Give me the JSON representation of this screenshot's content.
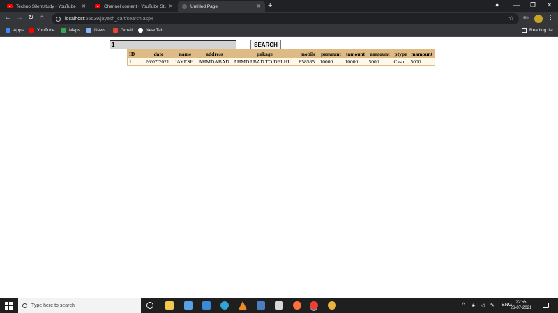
{
  "browser": {
    "tabs": [
      {
        "title": "Techno Silentstudy - YouTube",
        "close": "✕"
      },
      {
        "title": "Channel content - YouTube Studio",
        "close": "✕"
      },
      {
        "title": "Untitled Page",
        "close": "✕"
      }
    ],
    "new_tab": "+",
    "window_controls": {
      "minimize": "—",
      "maximize": "❐",
      "close": "✕"
    },
    "nav": {
      "back": "←",
      "forward": "→",
      "reload": "↻",
      "home": "⌂"
    },
    "address": {
      "host": "localhost",
      "path": ":56639/jayesh_cart/search.aspx"
    },
    "star": "☆",
    "extensions": "≡♪",
    "menu": "⋮",
    "bookmarks": [
      {
        "label": "Apps",
        "color": "#4285f4"
      },
      {
        "label": "YouTube",
        "color": "#ff0000"
      },
      {
        "label": "Maps",
        "color": "#34a853"
      },
      {
        "label": "News",
        "color": "#8ab4f8"
      },
      {
        "label": "Gmail",
        "color": "#ea4335"
      },
      {
        "label": "New Tab",
        "color": "#ffffff"
      }
    ],
    "reading_list": "Reading list"
  },
  "search": {
    "value": "1",
    "button_label": "SEARCH"
  },
  "results": {
    "columns": [
      "ID",
      "date",
      "name",
      "address",
      "pakage",
      "mobile",
      "pamount",
      "tamount",
      "aamount",
      "ptype",
      "mamount"
    ],
    "rows": [
      [
        "1",
        "26/07/2021",
        "JAYESH",
        "AHMDABAD",
        "AHMDABAD TO DELHI",
        "858585",
        "10000",
        "10000",
        "5000",
        "Cash",
        "5000"
      ]
    ]
  },
  "taskbar": {
    "search_placeholder": "Type here to search",
    "apps": [
      {
        "icon": "task-view",
        "color": "#1f1f1f"
      },
      {
        "icon": "file-explorer",
        "color": "#f2c94c"
      },
      {
        "icon": "download-app",
        "color": "#5aa0e6"
      },
      {
        "icon": "mail",
        "color": "#3b8ad9"
      },
      {
        "icon": "edge",
        "color": "#2fa5d8"
      },
      {
        "icon": "vlc",
        "color": "#f08a24"
      },
      {
        "icon": "python",
        "color": "#4a7fbf"
      },
      {
        "icon": "store",
        "color": "#d8d8d8"
      },
      {
        "icon": "firefox",
        "color": "#ff7139"
      },
      {
        "icon": "chrome",
        "color": "#e94235"
      },
      {
        "icon": "other-app",
        "color": "#e8b43a"
      }
    ],
    "tray": {
      "chevron": "^",
      "lang": "ENG"
    },
    "time": "22:55",
    "date": "26-07-2021"
  }
}
